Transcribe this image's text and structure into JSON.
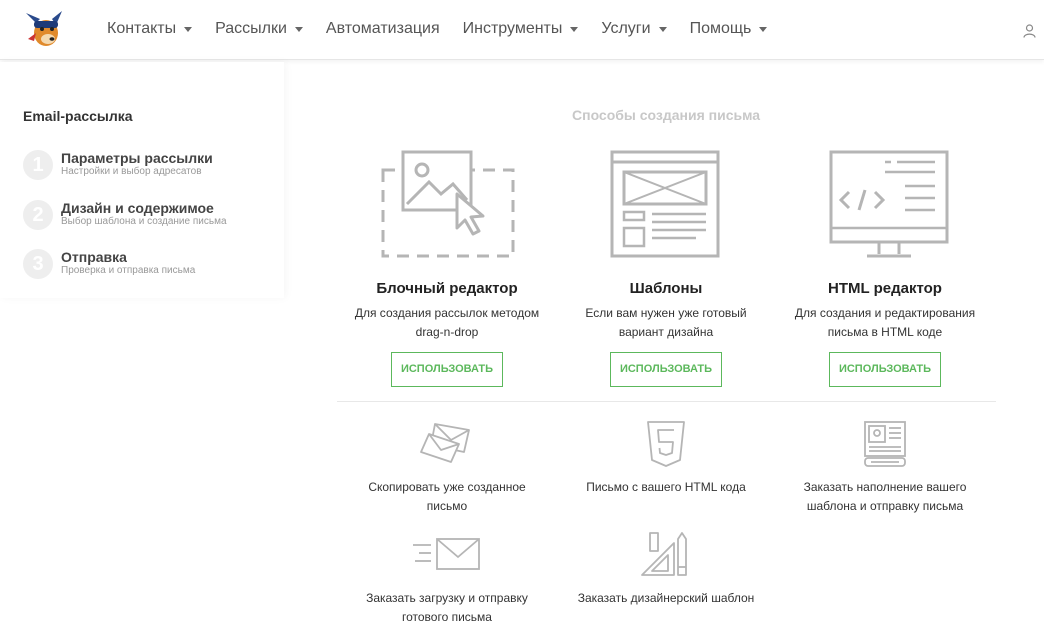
{
  "nav": {
    "items": [
      {
        "label": "Контакты",
        "dropdown": true
      },
      {
        "label": "Рассылки",
        "dropdown": true
      },
      {
        "label": "Автоматизация",
        "dropdown": false
      },
      {
        "label": "Инструменты",
        "dropdown": true
      },
      {
        "label": "Услуги",
        "dropdown": true
      },
      {
        "label": "Помощь",
        "dropdown": true
      }
    ]
  },
  "sidebar": {
    "title": "Email-рассылка",
    "steps": [
      {
        "num": "1",
        "title": "Параметры рассылки",
        "sub": "Настройки и выбор адресатов"
      },
      {
        "num": "2",
        "title": "Дизайн и содержимое",
        "sub": "Выбор шаблона и создание письма"
      },
      {
        "num": "3",
        "title": "Отправка",
        "sub": "Проверка и отправка письма"
      }
    ]
  },
  "main": {
    "section_title": "Способы создания письма",
    "methods": [
      {
        "icon": "drag-drop-editor-icon",
        "title": "Блочный редактор",
        "desc_line1": "Для создания рассылок методом",
        "desc_line2": "drag-n-drop",
        "button": "ИСПОЛЬЗОВАТЬ"
      },
      {
        "icon": "template-icon",
        "title": "Шаблоны",
        "desc_line1": "Если вам нужен уже готовый",
        "desc_line2": "вариант дизайна",
        "button": "ИСПОЛЬЗОВАТЬ"
      },
      {
        "icon": "html-editor-icon",
        "title": "HTML редактор",
        "desc_line1": "Для создания и редактирования",
        "desc_line2": "письма в HTML коде",
        "button": "ИСПОЛЬЗОВАТЬ"
      }
    ],
    "alternatives": [
      {
        "icon": "envelopes-icon",
        "line1": "Скопировать уже созданное",
        "line2": "письмо"
      },
      {
        "icon": "html5-icon",
        "line1": "Письмо с вашего HTML кода",
        "line2": ""
      },
      {
        "icon": "newsletter-order-icon",
        "line1": "Заказать наполнение вашего",
        "line2": "шаблона и отправку письма"
      },
      {
        "icon": "fast-mail-icon",
        "line1": "Заказать загрузку и отправку",
        "line2": "готового письма"
      },
      {
        "icon": "design-tools-icon",
        "line1": "Заказать дизайнерский шаблон",
        "line2": ""
      }
    ]
  },
  "colors": {
    "accent": "#5cb85c",
    "icon_gray": "#b5b5b5",
    "muted_title": "#c8c8c8"
  }
}
